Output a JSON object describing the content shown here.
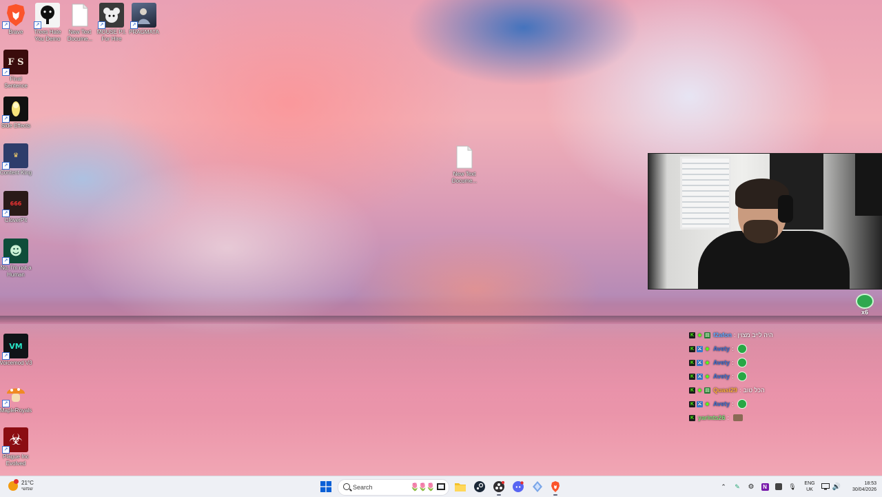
{
  "desktop": {
    "icons": [
      {
        "id": "brave",
        "label": "Brave",
        "glyph": "🦁",
        "color": "#fb542b"
      },
      {
        "id": "trees",
        "label": "Trees Hate You Demo",
        "glyph": "🌳",
        "color": "#f4f4f4"
      },
      {
        "id": "newtext1",
        "label": "New Text Docume...",
        "glyph": "",
        "color": "#ffffff"
      },
      {
        "id": "mousepi",
        "label": "MOUSE P.I. For Hire",
        "glyph": "🐭",
        "color": "#3a3a3a"
      },
      {
        "id": "pragmata",
        "label": "PRAGMATA",
        "glyph": "",
        "color": "#2b3344"
      },
      {
        "id": "finalsentence",
        "label": "Final Sentence",
        "glyph": "F S",
        "color": "#3a0c0c"
      },
      {
        "id": "sideeffects",
        "label": "Side Effects",
        "glyph": "●",
        "color": "#1a1a1a"
      },
      {
        "id": "contentking",
        "label": "Content King",
        "glyph": "CK",
        "color": "#2e3d6b"
      },
      {
        "id": "cloverpit",
        "label": "CloverPit",
        "glyph": "666",
        "color": "#3a2220"
      },
      {
        "id": "notahuman",
        "label": "No, I'm not a Human",
        "glyph": "☻",
        "color": "#0f4d3a"
      },
      {
        "id": "voicemod",
        "label": "Voicemod V3",
        "glyph": "VM",
        "color": "#101418"
      },
      {
        "id": "mapleroyals",
        "label": "MapleRoyals",
        "glyph": "🍄",
        "color": "transparent"
      },
      {
        "id": "plagueinc",
        "label": "Plague Inc Evolved",
        "glyph": "☣",
        "color": "#8b0d12"
      },
      {
        "id": "newtext2",
        "label": "New Text Docume...",
        "glyph": "",
        "color": "#ffffff"
      }
    ]
  },
  "chat": {
    "messages": [
      {
        "user": "f2afon",
        "color": "#5fa8ff",
        "text": "היה לייב מצוין",
        "emote": false
      },
      {
        "user": "Avety",
        "color": "#3a6fcf",
        "text": "",
        "emote": true
      },
      {
        "user": "Avety",
        "color": "#3a6fcf",
        "text": "",
        "emote": true
      },
      {
        "user": "Avety",
        "color": "#3a6fcf",
        "text": "",
        "emote": true
      },
      {
        "user": "Quasi29",
        "color": "#ffb13b",
        "text": "הכל טוב",
        "emote": false
      },
      {
        "user": "Avety",
        "color": "#3a6fcf",
        "text": "",
        "emote": true
      },
      {
        "user": "yarints26",
        "color": "#7fe37a",
        "text": "",
        "emote": true
      }
    ],
    "float_emote_count": "x6"
  },
  "taskbar": {
    "weather_temp": "21°C",
    "weather_condition": "שמשי",
    "search_placeholder": "Search",
    "language_line1": "ENG",
    "language_line2": "UK",
    "time": "18:53",
    "date": "30/04/2026",
    "colors": {
      "accent": "#0a5fd6",
      "brave": "#fb542b"
    }
  }
}
